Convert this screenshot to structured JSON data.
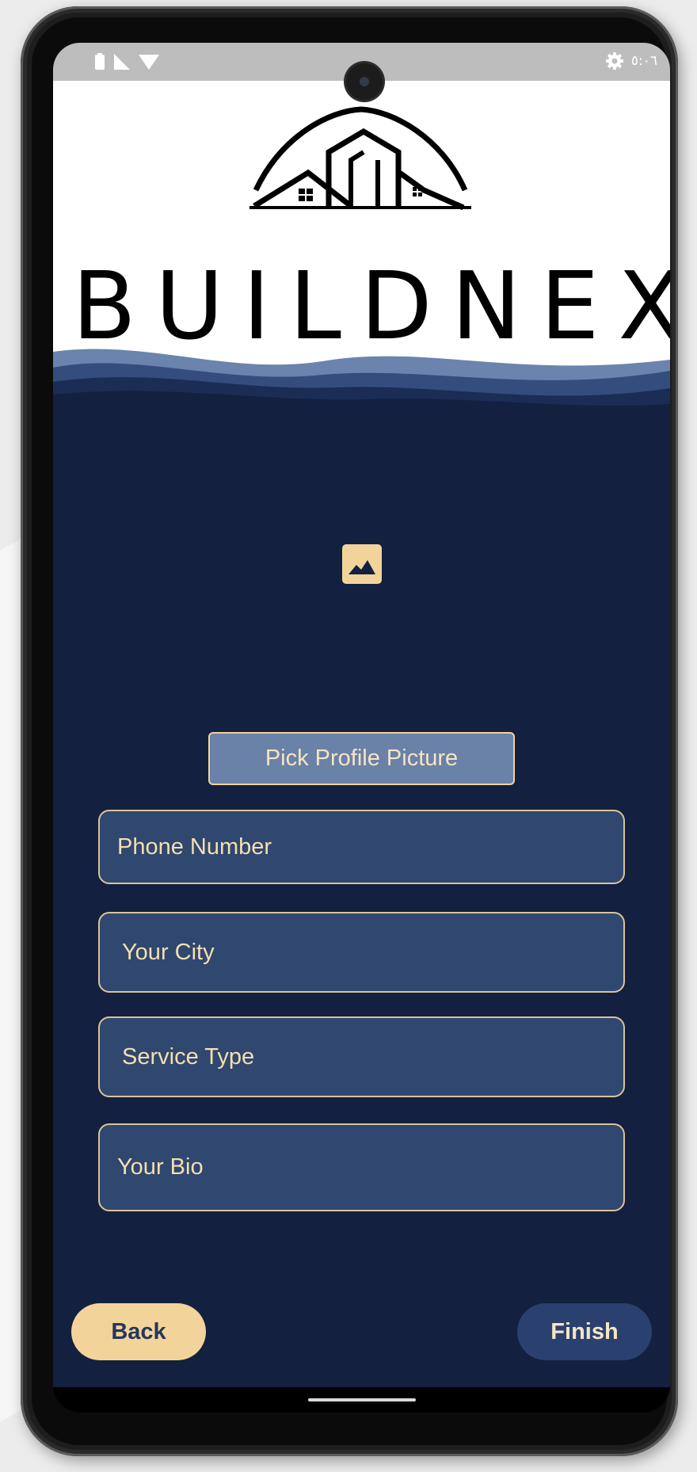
{
  "status_bar": {
    "time": "٥:٠٦",
    "icons": [
      "battery-icon",
      "signal-icon",
      "wifi-icon",
      "settings-icon"
    ]
  },
  "header": {
    "brand_name": "BUILDNEX",
    "logo": "buildnex-logo"
  },
  "profile": {
    "image_icon": "image-placeholder-icon",
    "pick_button_label": "Pick Profile Picture"
  },
  "form": {
    "phone_placeholder": "Phone Number",
    "city_placeholder": "Your City",
    "service_placeholder": "Service Type",
    "bio_placeholder": "Your Bio"
  },
  "actions": {
    "back_label": "Back",
    "finish_label": "Finish"
  },
  "colors": {
    "background": "#13203f",
    "accent": "#f2d49a",
    "field": "#30476f",
    "header": "#ffffff"
  }
}
